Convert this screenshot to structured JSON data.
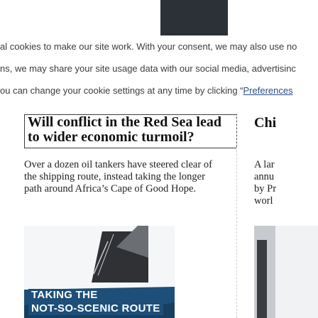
{
  "cookie_banner": {
    "line1": "al cookies to make our site work. With your consent, we may also use no",
    "line2": "ns, we may share your site usage data with our social media, advertisinc",
    "line3_prefix": "ou can change your cookie settings at any time by clicking “",
    "preferences_link": "Preferences"
  },
  "articles": [
    {
      "headline_line1": "Will conflict in the Red Sea lead",
      "headline_line2": "to wider economic turmoil?",
      "dek_lines": [
        "Over a dozen oil tankers have steered clear of",
        "the shipping route, instead taking the longer",
        "path around Africa’s Cape of Good Hope."
      ],
      "thumbnail_title_lines": [
        "TAKING THE",
        "NOT-SO-SCENIC ROUTE"
      ]
    },
    {
      "headline_partial": "Chi",
      "dek_lines": [
        "A lar",
        "annu",
        "by Pr",
        "worl"
      ]
    }
  ],
  "colors": {
    "cookie_link": "#2a4f87",
    "thumbnail_band": "#1d4f78",
    "top_block": "#2c3138"
  }
}
